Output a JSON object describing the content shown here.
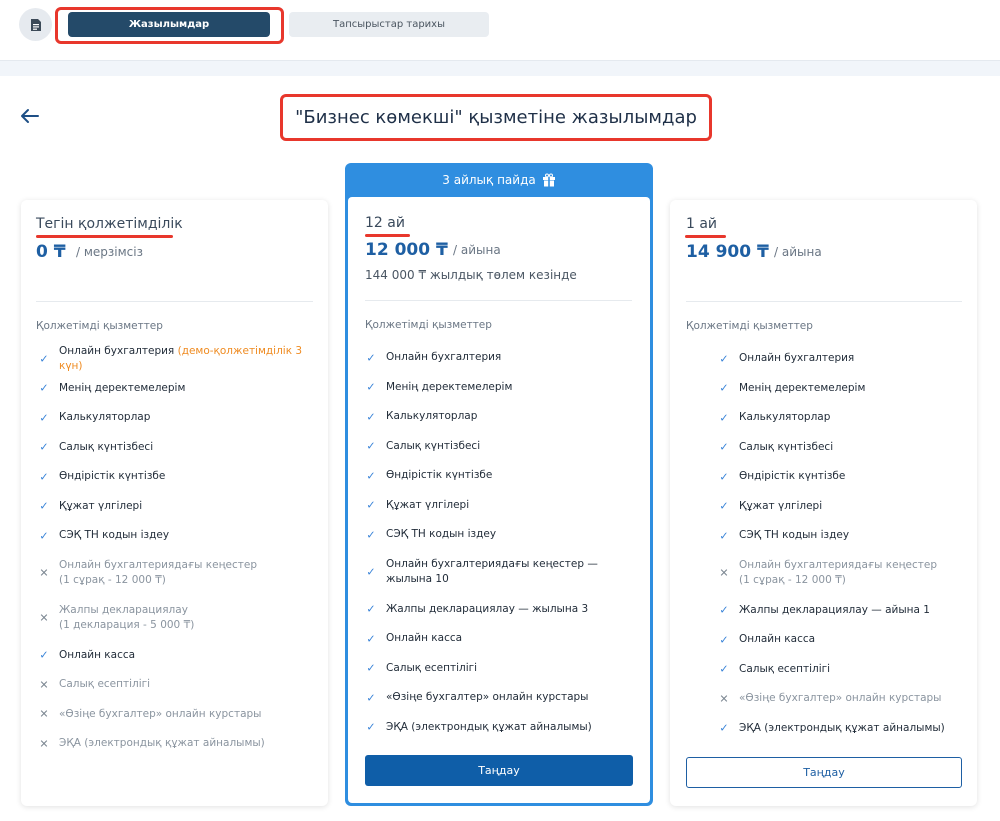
{
  "tabs": {
    "active": "Жазылымдар",
    "inactive": "Тапсырыстар тарихы"
  },
  "page_title": "\"Бизнес көмекші\" қызметіне жазылымдар",
  "promo_label": "3 айлық пайда",
  "section_label": "Қолжетімді қызметтер",
  "plans": [
    {
      "name": "Тегін қолжетімділік",
      "price": "0 ₸",
      "period": "/ мерзімсіз",
      "features": [
        {
          "text": "Онлайн бухгалтерия",
          "note": "(демо-қолжетімділік 3 күн)",
          "included": true
        },
        {
          "text": "Менің деректемелерім",
          "included": true
        },
        {
          "text": "Калькуляторлар",
          "included": true
        },
        {
          "text": "Салық күнтізбесі",
          "included": true
        },
        {
          "text": "Өндірістік күнтізбе",
          "included": true
        },
        {
          "text": "Құжат үлгілері",
          "included": true
        },
        {
          "text": "СЭҚ ТН кодын іздеу",
          "included": true
        },
        {
          "text": "Онлайн бухгалтериядағы кеңестер",
          "text2": "(1 сұрақ - 12 000 ₸)",
          "included": false
        },
        {
          "text": "Жалпы декларациялау",
          "text2": "(1 декларация - 5 000 ₸)",
          "included": false
        },
        {
          "text": "Онлайн касса",
          "included": true
        },
        {
          "text": "Салық есептілігі",
          "included": false
        },
        {
          "text": "«Өзіңе бухгалтер» онлайн курстары",
          "included": false
        },
        {
          "text": "ЭҚА (электрондық құжат айналымы)",
          "included": false
        }
      ]
    },
    {
      "name": "12 ай",
      "price": "12 000 ₸",
      "period": "/ айына",
      "annual_note": "144 000 ₸ жылдық төлем кезінде",
      "button": "Таңдау",
      "features": [
        {
          "text": "Онлайн бухгалтерия",
          "included": true
        },
        {
          "text": "Менің деректемелерім",
          "included": true
        },
        {
          "text": "Калькуляторлар",
          "included": true
        },
        {
          "text": "Салық күнтізбесі",
          "included": true
        },
        {
          "text": "Өндірістік күнтізбе",
          "included": true
        },
        {
          "text": "Құжат үлгілері",
          "included": true
        },
        {
          "text": "СЭҚ ТН кодын іздеу",
          "included": true
        },
        {
          "text": "Онлайн бухгалтериядағы кеңестер —",
          "text2": "жылына 10",
          "included": true
        },
        {
          "text": "Жалпы декларациялау — жылына 3",
          "included": true
        },
        {
          "text": "Онлайн касса",
          "included": true
        },
        {
          "text": "Салық есептілігі",
          "included": true
        },
        {
          "text": "«Өзіңе бухгалтер» онлайн курстары",
          "included": true
        },
        {
          "text": "ЭҚА (электрондық құжат айналымы)",
          "included": true
        }
      ]
    },
    {
      "name": "1 ай",
      "price": "14 900 ₸",
      "period": "/ айына",
      "button": "Таңдау",
      "features": [
        {
          "text": "Онлайн бухгалтерия",
          "included": true
        },
        {
          "text": "Менің деректемелерім",
          "included": true
        },
        {
          "text": "Калькуляторлар",
          "included": true
        },
        {
          "text": "Салық күнтізбесі",
          "included": true
        },
        {
          "text": "Өндірістік күнтізбе",
          "included": true
        },
        {
          "text": "Құжат үлгілері",
          "included": true
        },
        {
          "text": "СЭҚ ТН кодын іздеу",
          "included": true
        },
        {
          "text": "Онлайн бухгалтериядағы кеңестер",
          "text2": "(1 сұрақ - 12 000 ₸)",
          "included": false
        },
        {
          "text": "Жалпы декларациялау — айына 1",
          "included": true
        },
        {
          "text": "Онлайн касса",
          "included": true
        },
        {
          "text": "Салық есептілігі",
          "included": true
        },
        {
          "text": "«Өзіңе бухгалтер» онлайн курстары",
          "included": false
        },
        {
          "text": "ЭҚА (электрондық құжат айналымы)",
          "included": true
        }
      ]
    }
  ],
  "icons": {
    "document": "document-icon",
    "back": "arrow-left-icon",
    "gift": "gift-icon",
    "check": "check-icon",
    "cross": "cross-icon"
  },
  "colors": {
    "accent": "#1e5fa3",
    "tab_active": "#244a69",
    "promo": "#2f8ee0",
    "highlight_frame": "#e8372c",
    "demo_note": "#ef8b21"
  }
}
